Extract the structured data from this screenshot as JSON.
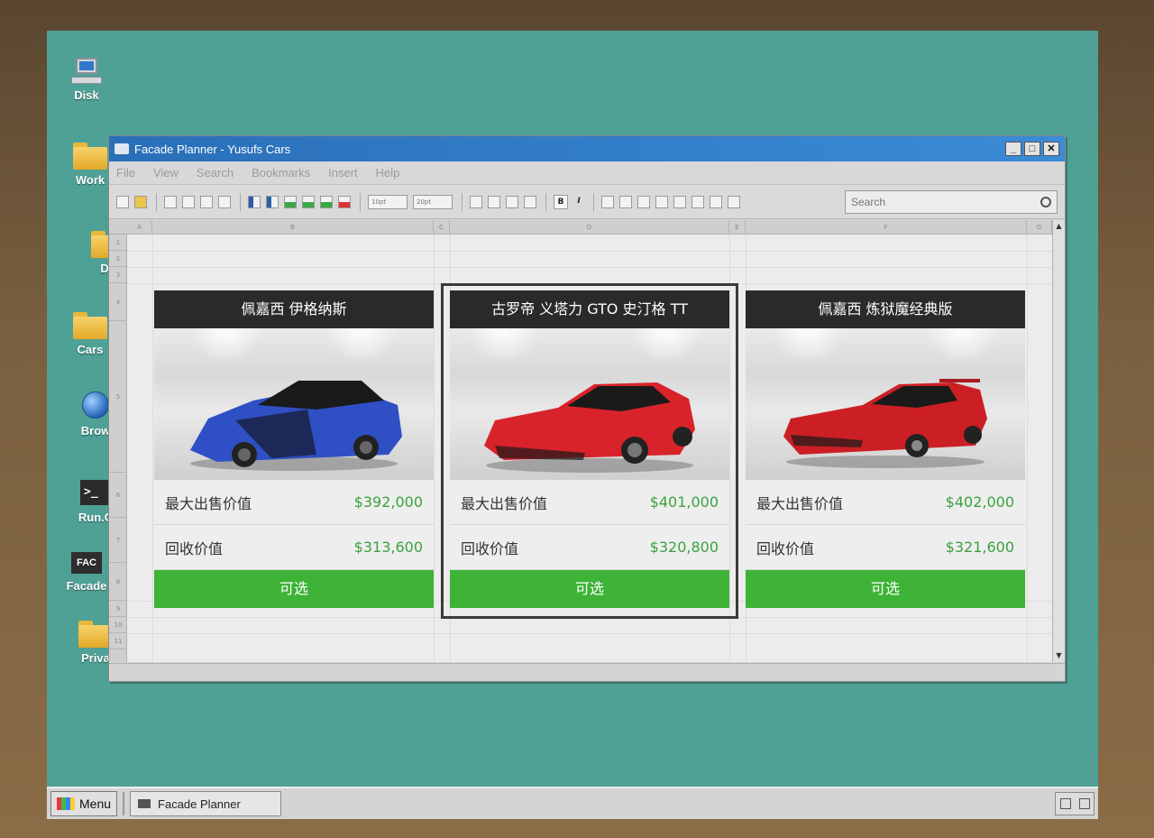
{
  "desktop": {
    "icons": [
      {
        "label": "Disk",
        "icon": "computer-icon"
      },
      {
        "label": "Work",
        "icon": "folder-icon"
      },
      {
        "label": "Do",
        "icon": "folder-icon"
      },
      {
        "label": "Cars",
        "icon": "folder-icon"
      },
      {
        "label": "Brow",
        "icon": "globe-icon"
      },
      {
        "label": "Run.C",
        "icon": "terminal-icon"
      },
      {
        "label": "Facade",
        "icon": "facade-icon"
      },
      {
        "label": "Priva",
        "icon": "folder-icon"
      }
    ]
  },
  "window": {
    "title": "Facade Planner - Yusufs Cars",
    "minimize": "_",
    "maximize": "□",
    "close": "✕"
  },
  "menu": [
    "File",
    "View",
    "Search",
    "Bookmarks",
    "Insert",
    "Help"
  ],
  "toolbar": {
    "font_size_a": "10pt",
    "font_size_b": "20pt",
    "bold": "B",
    "italic": "I",
    "search_placeholder": "Search"
  },
  "sheet": {
    "columns": [
      "A",
      "B",
      "C",
      "D",
      "E",
      "F",
      "G"
    ],
    "rows": [
      "1",
      "2",
      "3",
      "4",
      "5",
      "6",
      "7",
      "8",
      "9",
      "10",
      "11"
    ]
  },
  "cards": [
    {
      "title": "佩嘉西 伊格纳斯",
      "max_label": "最大出售价值",
      "max_price": "$392,000",
      "sell_label": "回收价值",
      "sell_price": "$313,600",
      "button": "可选",
      "car_color": "#2f4fc4",
      "selected": false
    },
    {
      "title": "古罗帝 义塔力 GTO 史汀格 TT",
      "max_label": "最大出售价值",
      "max_price": "$401,000",
      "sell_label": "回收价值",
      "sell_price": "$320,800",
      "button": "可选",
      "car_color": "#d8232a",
      "selected": true
    },
    {
      "title": "佩嘉西 炼狱魔经典版",
      "max_label": "最大出售价值",
      "max_price": "$402,000",
      "sell_label": "回收价值",
      "sell_price": "$321,600",
      "button": "可选",
      "car_color": "#cc1f24",
      "selected": false
    }
  ],
  "taskbar": {
    "menu_label": "Menu",
    "task_label": "Facade Planner"
  },
  "colors": {
    "desktop": "#4fa095",
    "accent_green": "#3eb337",
    "price_green": "#3aa23f",
    "titlebar": "#2a6fb8"
  }
}
